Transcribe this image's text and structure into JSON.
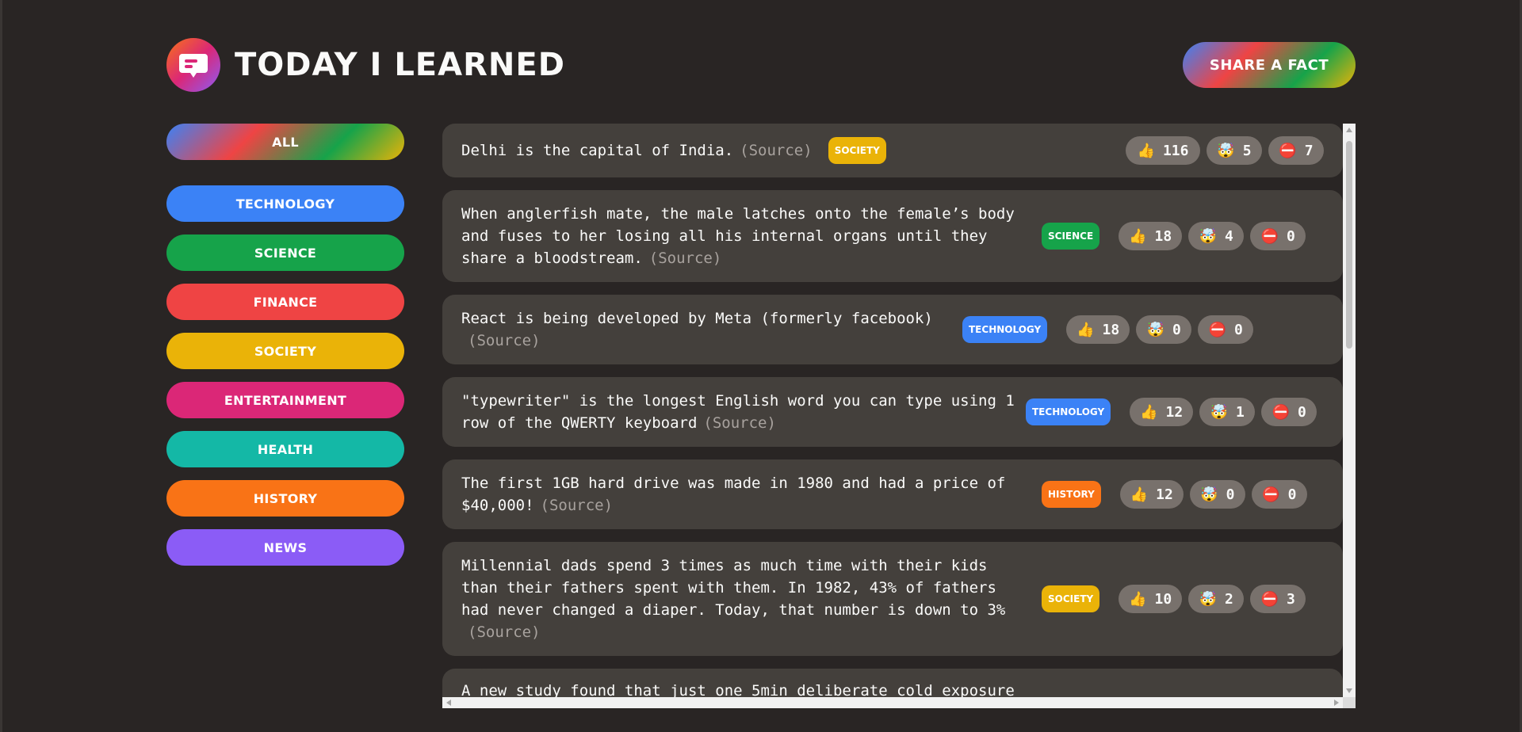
{
  "app": {
    "title": "Today I Learned",
    "share_label": "Share a fact"
  },
  "icons": {
    "logo": "chat-bubble-icon",
    "like": "👍",
    "mindblowing": "🤯",
    "false": "⛔"
  },
  "categories": [
    {
      "label": "All",
      "color": "gradient"
    },
    {
      "label": "technology",
      "color": "#3b82f6"
    },
    {
      "label": "science",
      "color": "#16a34a"
    },
    {
      "label": "finance",
      "color": "#ef4444"
    },
    {
      "label": "society",
      "color": "#eab308"
    },
    {
      "label": "entertainment",
      "color": "#db2777"
    },
    {
      "label": "health",
      "color": "#14b8a6"
    },
    {
      "label": "history",
      "color": "#f97316"
    },
    {
      "label": "news",
      "color": "#8b5cf6"
    }
  ],
  "facts": [
    {
      "text": "Delhi is the capital of India.",
      "source": "(Source)",
      "category": "society",
      "color": "#eab308",
      "likes": "116",
      "mind": "5",
      "false": "7"
    },
    {
      "text": "When anglerfish mate, the male latches onto the female’s body and fuses to her losing all his internal organs until they share a bloodstream.",
      "source": "(Source)",
      "category": "science",
      "color": "#16a34a",
      "likes": "18",
      "mind": "4",
      "false": "0"
    },
    {
      "text": "React is being developed by Meta (formerly facebook)",
      "source": "(Source)",
      "category": "technology",
      "color": "#3b82f6",
      "likes": "18",
      "mind": "0",
      "false": "0"
    },
    {
      "text": "\"typewriter\" is the longest English word you can type using 1 row of the QWERTY keyboard",
      "source": "(Source)",
      "category": "technology",
      "color": "#3b82f6",
      "likes": "12",
      "mind": "1",
      "false": "0"
    },
    {
      "text": "The first 1GB hard drive was made in 1980 and had a price of $40,000!",
      "source": "(Source)",
      "category": "history",
      "color": "#f97316",
      "likes": "12",
      "mind": "0",
      "false": "0"
    },
    {
      "text": "Millennial dads spend 3 times as much time with their kids than their fathers spent with them. In 1982, 43% of fathers had never changed a diaper. Today, that number is down to 3%",
      "source": "(Source)",
      "category": "society",
      "color": "#eab308",
      "likes": "10",
      "mind": "2",
      "false": "3"
    },
    {
      "text": "A new study found that just one 5min deliberate cold exposure",
      "source": "",
      "category": "",
      "color": "",
      "likes": "",
      "mind": "",
      "false": ""
    }
  ]
}
